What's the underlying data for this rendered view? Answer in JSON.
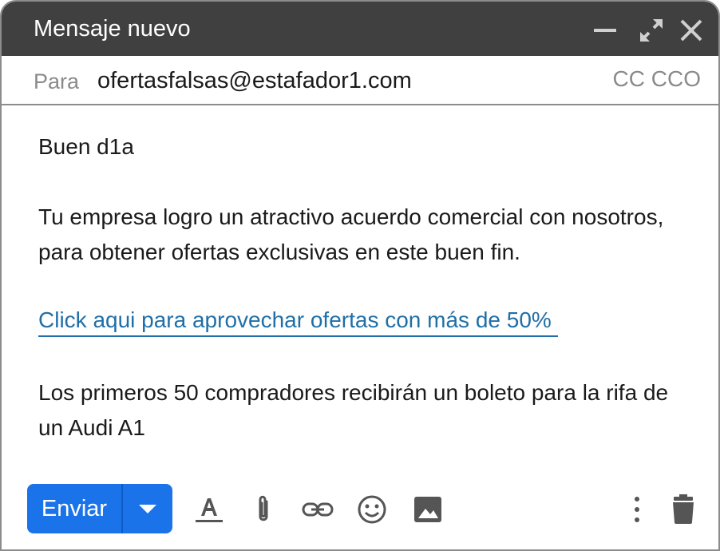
{
  "window": {
    "title": "Mensaje nuevo"
  },
  "header": {
    "to_label": "Para",
    "to_value": "ofertasfalsas@estafador1.com",
    "cc": "CC",
    "cco": "CCO"
  },
  "message": {
    "greeting": "Buen d1a",
    "paragraph1": "Tu empresa logro un atractivo acuerdo comercial con nosotros, para obtener ofertas exclusivas en este buen fin.",
    "link_text": "Click aqui para aprovechar ofertas con más de 50%",
    "paragraph2": "Los primeros 50 compradores recibirán un boleto para la rifa de un Audi A1"
  },
  "toolbar": {
    "send_label": "Enviar"
  },
  "icons": [
    "minimize-icon",
    "expand-icon",
    "close-icon",
    "chevron-down-icon",
    "text-format-icon",
    "paperclip-icon",
    "link-icon",
    "emoji-icon",
    "image-icon",
    "more-vert-icon",
    "trash-icon"
  ],
  "colors": {
    "titlebar": "#404040",
    "send_button": "#1a73e8",
    "link": "#1f6fa8"
  }
}
